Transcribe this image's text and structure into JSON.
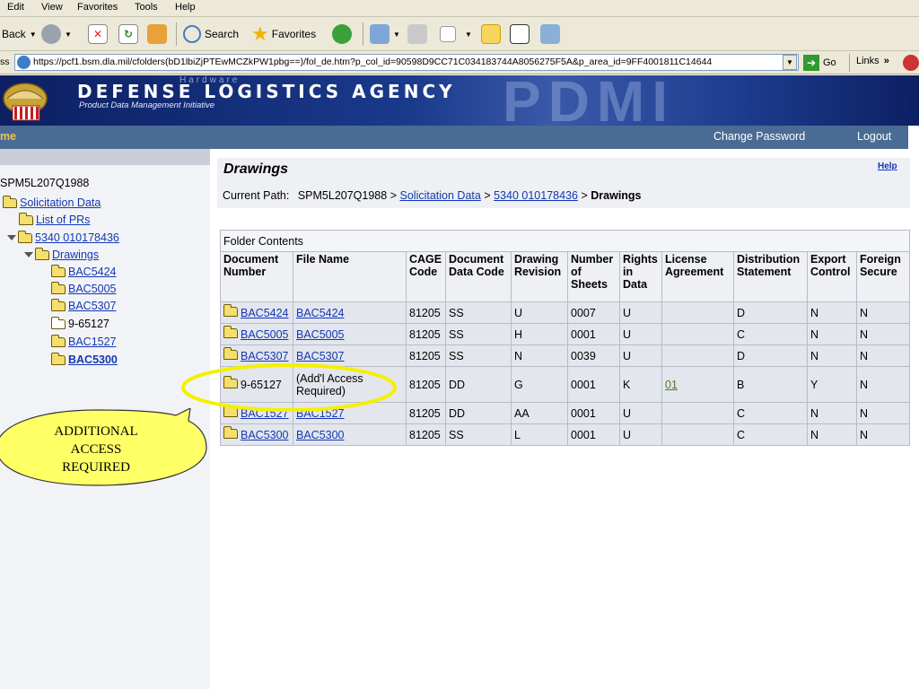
{
  "menu": [
    "Edit",
    "View",
    "Favorites",
    "Tools",
    "Help"
  ],
  "toolbar": {
    "back": "Back",
    "search": "Search",
    "favorites": "Favorites"
  },
  "address": {
    "label": "ss",
    "url": "https://pcf1.bsm.dla.mil/cfolders(bD1lbiZjPTEwMCZkPW1pbg==)/fol_de.htm?p_col_id=90598D9CC71C034183744A8056275F5A&p_area_id=9FF4001811C14644",
    "go": "Go",
    "links": "Links"
  },
  "banner": {
    "title": "DEFENSE LOGISTICS AGENCY",
    "subtitle": "Product Data Management Initiative",
    "watermark1": "Hardware",
    "watermark2": "PDMI"
  },
  "nav": {
    "home": "me",
    "change_password": "Change Password",
    "logout": "Logout"
  },
  "tree": {
    "root": "SPM5L207Q1988",
    "solicitation": "Solicitation Data",
    "list_prs": "List of PRs",
    "nsn": "5340 010178436",
    "drawings": "Drawings",
    "items": [
      "BAC5424",
      "BAC5005",
      "BAC5307",
      "9-65127",
      "BAC1527",
      "BAC5300"
    ]
  },
  "content": {
    "title": "Drawings",
    "help": "Help",
    "path_label": "Current Path:",
    "path_root": "SPM5L207Q1988",
    "path_sep": ">",
    "path_link1": "Solicitation Data",
    "path_link2": "5340 010178436",
    "path_current": "Drawings",
    "folder_contents": "Folder Contents"
  },
  "table": {
    "headers": [
      "Document Number",
      "File Name",
      "CAGE Code",
      "Document Data Code",
      "Drawing Revision",
      "Number of Sheets",
      "Rights in Data",
      "License Agreement",
      "Distribution Statement",
      "Export Control",
      "Foreign Secure"
    ],
    "rows": [
      [
        "BAC5424",
        "BAC5424",
        "81205",
        "SS",
        "U",
        "0007",
        "U",
        "",
        "D",
        "N",
        "N"
      ],
      [
        "BAC5005",
        "BAC5005",
        "81205",
        "SS",
        "H",
        "0001",
        "U",
        "",
        "C",
        "N",
        "N"
      ],
      [
        "BAC5307",
        "BAC5307",
        "81205",
        "SS",
        "N",
        "0039",
        "U",
        "",
        "D",
        "N",
        "N"
      ],
      [
        "9-65127",
        "(Add'l Access Required)",
        "81205",
        "DD",
        "G",
        "0001",
        "K",
        "01",
        "B",
        "Y",
        "N"
      ],
      [
        "BAC1527",
        "BAC1527",
        "81205",
        "DD",
        "AA",
        "0001",
        "U",
        "",
        "C",
        "N",
        "N"
      ],
      [
        "BAC5300",
        "BAC5300",
        "81205",
        "SS",
        "L",
        "0001",
        "U",
        "",
        "C",
        "N",
        "N"
      ]
    ]
  },
  "callout": {
    "line1": "ADDITIONAL",
    "line2": "ACCESS",
    "line3": "REQUIRED"
  }
}
